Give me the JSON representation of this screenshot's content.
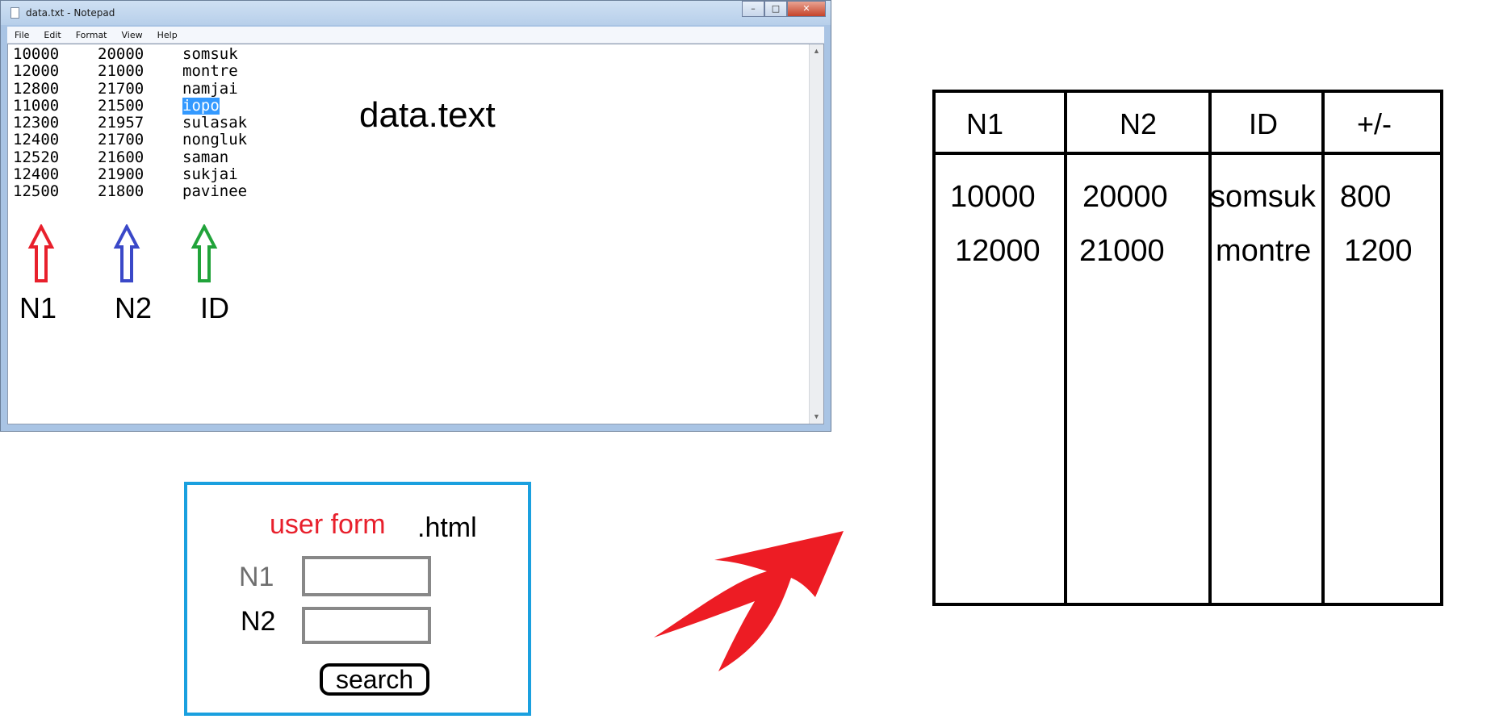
{
  "notepad": {
    "title": "data.txt - Notepad",
    "controls": {
      "minimize": "–",
      "maximize": "□",
      "close": "✕"
    },
    "menu": [
      "File",
      "Edit",
      "Format",
      "View",
      "Help"
    ],
    "rows": [
      [
        "10000",
        "20000",
        "somsuk"
      ],
      [
        "12000",
        "21000",
        "montre"
      ],
      [
        "12800",
        "21700",
        "namjai"
      ],
      [
        "11000",
        "21500",
        "iopo"
      ],
      [
        "12300",
        "21957",
        "sulasak"
      ],
      [
        "12400",
        "21700",
        "nongluk"
      ],
      [
        "12520",
        "21600",
        "saman"
      ],
      [
        "12400",
        "21900",
        "sukjai"
      ],
      [
        "12500",
        "21800",
        "pavinee"
      ]
    ],
    "selected_text": "iopo"
  },
  "annotation": {
    "file_label": "data.text",
    "column_labels": [
      "N1",
      "N2",
      "ID"
    ],
    "arrow_colors": [
      "#e8202c",
      "#3a48c8",
      "#21a33a"
    ]
  },
  "user_form": {
    "title": "user form",
    "extension": ".html",
    "n1_label": "N1",
    "n2_label": "N2",
    "search_label": "search",
    "border_color": "#1aa0df",
    "title_color": "#e8202c"
  },
  "result_table": {
    "headers": [
      "N1",
      "N2",
      "ID",
      "+/-"
    ],
    "rows": [
      [
        "10000",
        "20000",
        "somsuk",
        "800"
      ],
      [
        "12000",
        "21000",
        "montre",
        "1200"
      ]
    ]
  },
  "transfer_arrow_color": "#ed1c24"
}
